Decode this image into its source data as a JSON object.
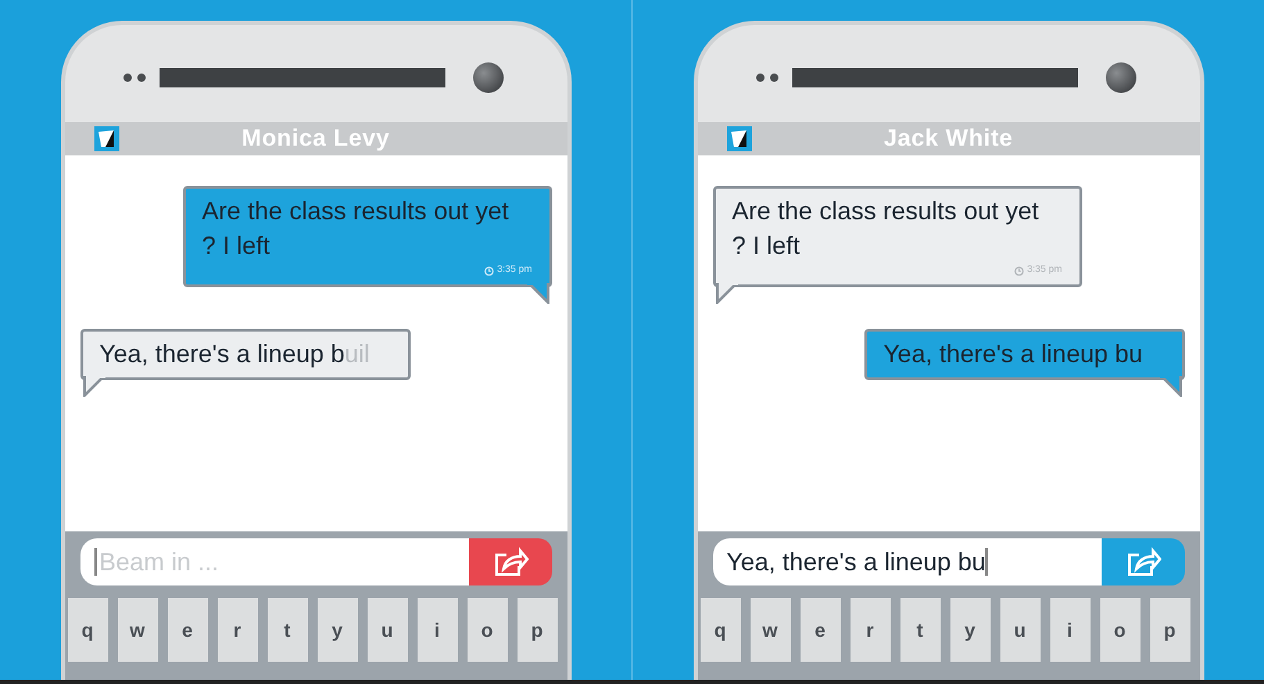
{
  "phones": [
    {
      "contact": "Monica Levy",
      "messages": [
        {
          "kind": "outgoing",
          "text": "Are the class results out yet ? I left",
          "time": "3:35 pm"
        },
        {
          "kind": "incoming",
          "text": "Yea, there's a lineup b",
          "faded_text": "uil"
        }
      ],
      "input": {
        "placeholder": "Beam in ..."
      },
      "send_button": {
        "color": "#e8474f"
      },
      "keys": [
        "q",
        "w",
        "e",
        "r",
        "t",
        "y",
        "u",
        "i",
        "o",
        "p"
      ]
    },
    {
      "contact": "Jack White",
      "messages": [
        {
          "kind": "incoming",
          "text": "Are the class results out yet ? I left",
          "time": "3:35 pm"
        },
        {
          "kind": "outgoing",
          "text": "Yea, there's a lineup bu"
        }
      ],
      "input": {
        "value": "Yea, there's a lineup bu"
      },
      "send_button": {
        "color": "#1ea3dc"
      },
      "keys": [
        "q",
        "w",
        "e",
        "r",
        "t",
        "y",
        "u",
        "i",
        "o",
        "p"
      ]
    }
  ]
}
